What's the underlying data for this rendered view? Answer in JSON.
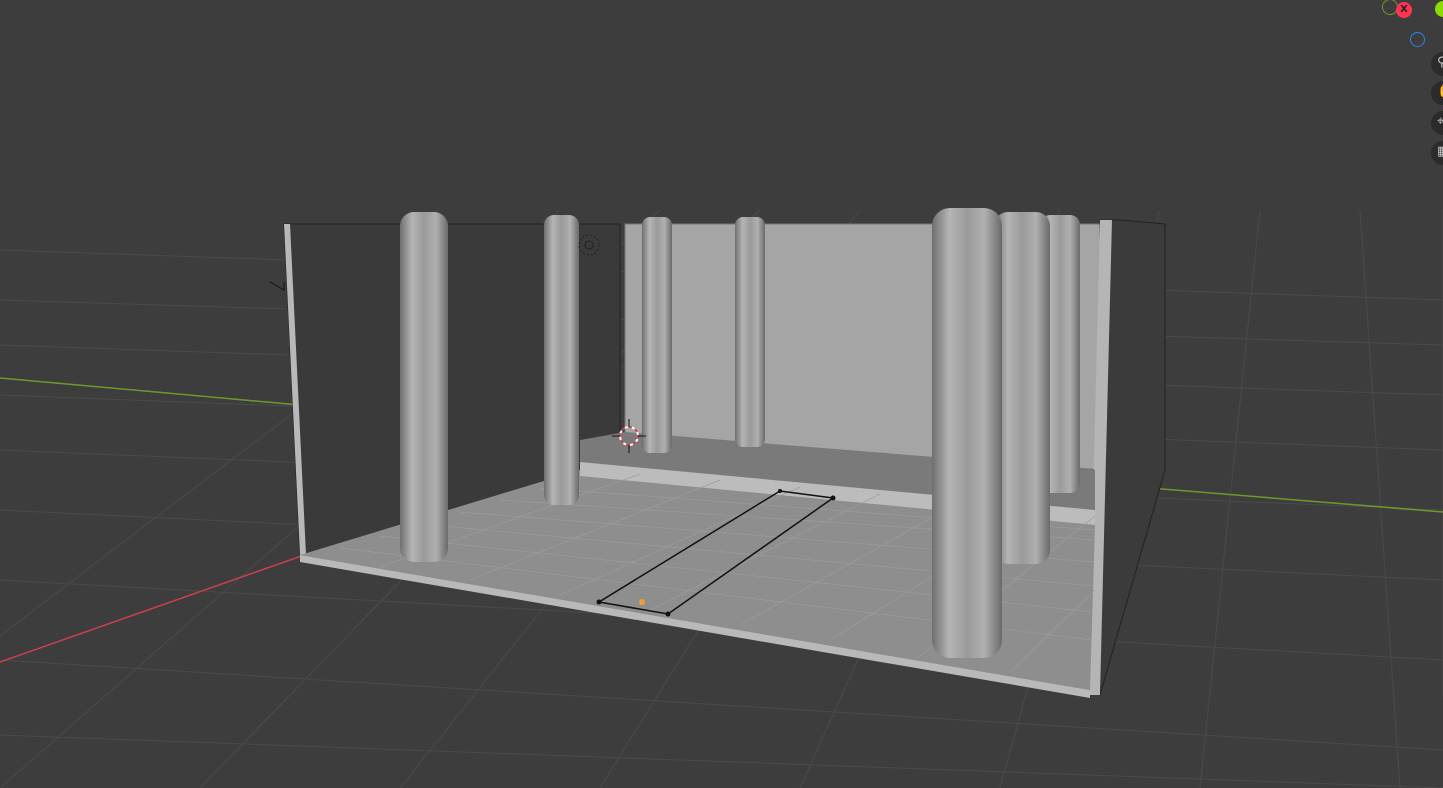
{
  "viewport": {
    "background": "#3d3d3d",
    "grid_color": "#4c4c4c",
    "x_axis_color": "#c9414e",
    "y_axis_color": "#6c9a2a"
  },
  "nav_gizmo": {
    "x_label": "X",
    "x_color": "#ff3352",
    "y_color": "#8bdc00",
    "z_color": "#2f83e6"
  },
  "navigation_tools": [
    {
      "name": "zoom-icon",
      "glyph": "⚲"
    },
    {
      "name": "orbit-hand-icon",
      "glyph": "✋"
    },
    {
      "name": "camera-icon",
      "glyph": "⌖"
    },
    {
      "name": "perspective-grid-icon",
      "glyph": "▦"
    }
  ],
  "scene": {
    "wall_color": "#a3a3a3",
    "floor_color": "#8f8f8f",
    "column_color": "#9a9a9a",
    "origin_color": "#f0a030"
  }
}
